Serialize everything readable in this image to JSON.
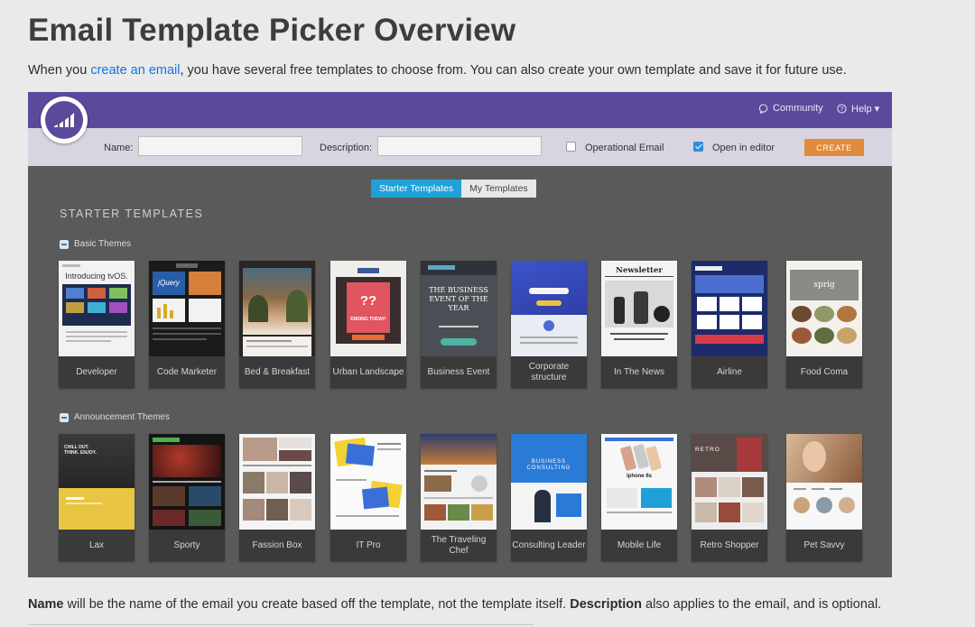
{
  "page": {
    "title": "Email Template Picker Overview",
    "intro_before": "When you ",
    "intro_link": "create an email",
    "intro_after": ", you have several free templates to choose from. You can also create your own template and save it for future use.",
    "footer_name_bold": "Name",
    "footer_mid": " will be the name of the email you create based off the template, not the template itself. ",
    "footer_desc_bold": "Description",
    "footer_end": " also applies to the email, and is optional."
  },
  "topbar": {
    "community_label": "Community",
    "help_label": "Help ▾"
  },
  "form": {
    "name_label": "Name:",
    "name_value": "",
    "description_label": "Description:",
    "description_value": "",
    "operational_label": "Operational Email",
    "operational_checked": false,
    "open_editor_label": "Open in editor",
    "open_editor_checked": true,
    "create_label": "CREATE"
  },
  "tabs": [
    {
      "label": "Starter Templates",
      "active": true
    },
    {
      "label": "My Templates",
      "active": false
    }
  ],
  "section_title": "STARTER TEMPLATES",
  "groups": [
    {
      "label": "Basic Themes",
      "templates": [
        {
          "name": "Developer",
          "thumb_text": "Introducing tvOS."
        },
        {
          "name": "Code Marketer",
          "thumb_text": "jQuery"
        },
        {
          "name": "Bed & Breakfast",
          "thumb_text": ""
        },
        {
          "name": "Urban Landscape",
          "thumb_text": "ENDING TODAY!"
        },
        {
          "name": "Business Event",
          "thumb_text": "THE BUSINESS EVENT OF THE YEAR"
        },
        {
          "name": "Corporate structure",
          "thumb_text": ""
        },
        {
          "name": "In The News",
          "thumb_text": "Newsletter"
        },
        {
          "name": "Airline",
          "thumb_text": ""
        },
        {
          "name": "Food Coma",
          "thumb_text": "sprig"
        }
      ]
    },
    {
      "label": "Announcement Themes",
      "templates": [
        {
          "name": "Lax",
          "thumb_text": "CHILL OUT. THINK. ENJOY."
        },
        {
          "name": "Sporty",
          "thumb_text": ""
        },
        {
          "name": "Fassion Box",
          "thumb_text": ""
        },
        {
          "name": "IT Pro",
          "thumb_text": ""
        },
        {
          "name": "The Traveling Chef",
          "thumb_text": ""
        },
        {
          "name": "Consulting Leader",
          "thumb_text": "BUSINESS CONSULTING"
        },
        {
          "name": "Mobile Life",
          "thumb_text": "iphone 6s"
        },
        {
          "name": "Retro Shopper",
          "thumb_text": "RETRO"
        },
        {
          "name": "Pet Savvy",
          "thumb_text": ""
        }
      ]
    }
  ],
  "colors": {
    "topbar": "#5b4a9b",
    "formbar": "#d8d4e0",
    "canvas": "#5a5a5a",
    "create_button": "#e08a3a",
    "active_tab": "#1fa1d8",
    "link": "#1473e6"
  }
}
